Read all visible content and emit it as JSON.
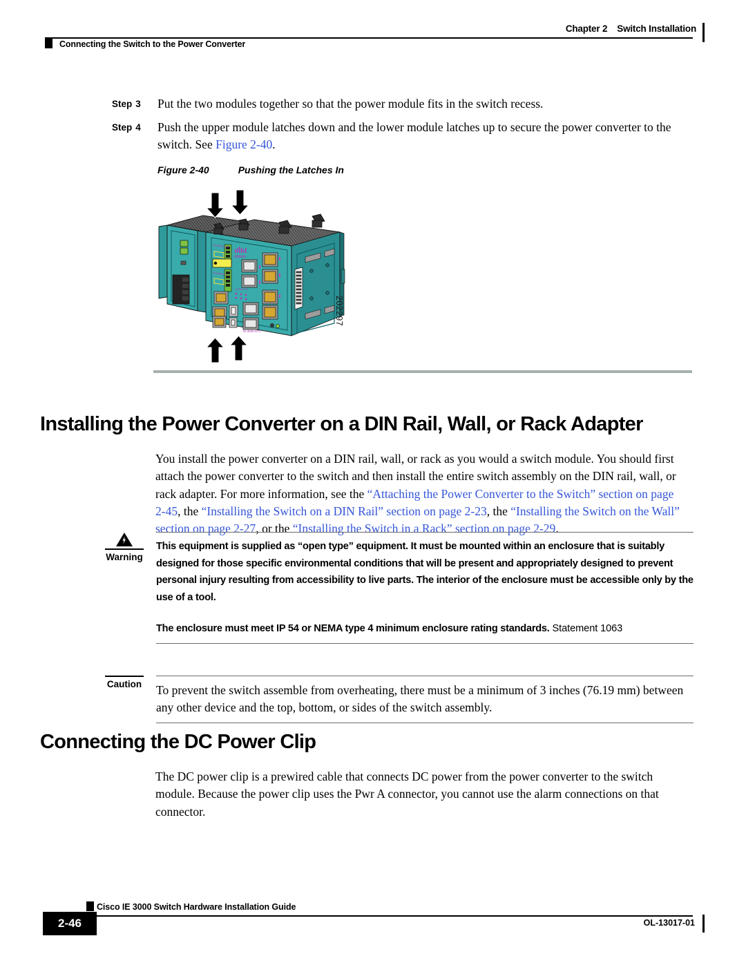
{
  "header": {
    "chapter_label": "Chapter 2",
    "chapter_title": "Switch Installation",
    "running_head": "Connecting the Switch to the Power Converter"
  },
  "steps": [
    {
      "label": "Step",
      "number": "3",
      "text": "Put the two modules together so that the power module fits in the switch recess."
    },
    {
      "label": "Step",
      "number": "4",
      "text_before": "Push the upper module latches down and the lower module latches up to secure the power converter to the switch. See ",
      "xref": "Figure 2-40",
      "text_after": "."
    }
  ],
  "figure": {
    "caption_label": "Figure 2-40",
    "caption_title": "Pushing the Latches In",
    "art_number": "202297",
    "alt": "Isometric drawing of a teal Cisco IE 3000 switch with an attached power converter module; black arrows point down onto the two upper latches and up onto the two lower latches."
  },
  "sections": [
    {
      "heading": "Installing the Power Converter on a DIN Rail, Wall, or Rack Adapter",
      "paragraph": {
        "p1": "You install the power converter on a DIN rail, wall, or rack as you would a switch module. You should first attach the power converter to the switch and then install the entire switch assembly on the DIN rail, wall, or rack adapter. For more information, see the ",
        "x1": "“Attaching the Power Converter to the Switch” section on page 2-45",
        "p2": ", the ",
        "x2": "“Installing the Switch on a DIN Rail” section on page 2-23",
        "p3": ", the ",
        "x3": "“Installing the Switch on the Wall” section on page 2-27",
        "p4": ", or the ",
        "x4": "“Installing the Switch in a Rack” section on page 2-29",
        "p5": "."
      }
    },
    {
      "heading": "Connecting the DC Power Clip",
      "paragraph": {
        "p1": "The DC power clip is a prewired cable that connects DC power from the power converter to the switch module. Because the power clip uses the Pwr A connector, you cannot use the alarm connections on that connector."
      }
    }
  ],
  "admonitions": {
    "warning": {
      "label": "Warning",
      "icon": "warning-triangle-icon",
      "text": "This equipment is supplied as “open type” equipment. It must be mounted within an enclosure that is suitably designed for those specific environmental conditions that will be present and appropriately designed to prevent personal injury resulting from accessibility to live parts. The interior of the enclosure must be accessible only by the use of a tool."
    },
    "statement": {
      "bold_text": "The enclosure must meet IP 54 or NEMA type 4 minimum enclosure rating standards.",
      "normal_text": " Statement 1063"
    },
    "caution": {
      "label": "Caution",
      "text": "To prevent the switch assemble from overheating, there must be a minimum of 3 inches (76.19 mm) between any other device and the top, bottom, or sides of the switch assembly."
    }
  },
  "footer": {
    "guide_title": "Cisco IE 3000 Switch Hardware Installation Guide",
    "page_number": "2-46",
    "doc_id": "OL-13017-01"
  },
  "colors": {
    "xref_blue": "#3456d8",
    "rule_gray": "#a6b0ae",
    "chassis_teal": "#3aa8a8",
    "chassis_teal_dark": "#1d7f83",
    "chassis_teal_light": "#57c2c0"
  }
}
